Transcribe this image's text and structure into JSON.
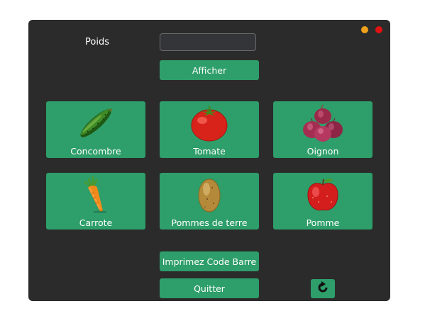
{
  "window": {
    "controls": [
      "minimize",
      "close"
    ],
    "colors": {
      "minimize": "#f0a11b",
      "close": "#e01212",
      "background": "#2b2b2b",
      "accent": "#2e9e6a"
    }
  },
  "form": {
    "weight_label": "Poids",
    "weight_value": "",
    "display_button": "Afficher"
  },
  "products": [
    {
      "label": "Concombre",
      "icon": "cucumber-icon"
    },
    {
      "label": "Tomate",
      "icon": "tomato-icon"
    },
    {
      "label": "Oignon",
      "icon": "onion-icon"
    },
    {
      "label": "Carrote",
      "icon": "carrot-icon"
    },
    {
      "label": "Pommes de terre",
      "icon": "potato-icon"
    },
    {
      "label": "Pomme",
      "icon": "apple-icon"
    }
  ],
  "actions": {
    "print_barcode": "Imprimez Code Barre",
    "quit": "Quitter",
    "refresh_icon": "refresh-icon"
  }
}
